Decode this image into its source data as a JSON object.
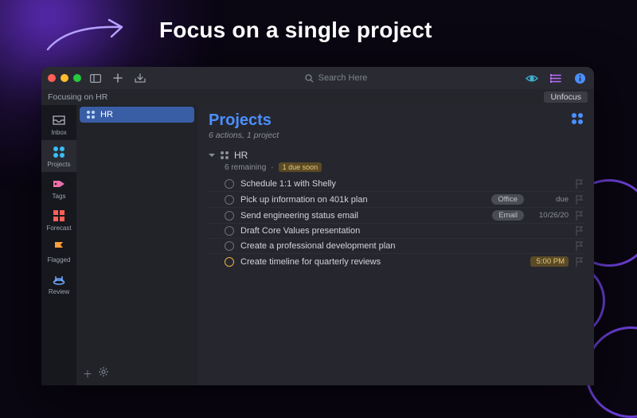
{
  "hero": {
    "title": "Focus on a single project"
  },
  "titlebar": {
    "search_placeholder": "Search Here"
  },
  "focusbar": {
    "text": "Focusing on HR",
    "unfocus_label": "Unfocus"
  },
  "rail": {
    "items": [
      {
        "label": "Inbox",
        "icon": "inbox-icon"
      },
      {
        "label": "Projects",
        "icon": "projects-icon"
      },
      {
        "label": "Tags",
        "icon": "tag-icon"
      },
      {
        "label": "Forecast",
        "icon": "forecast-icon"
      },
      {
        "label": "Flagged",
        "icon": "flag-icon"
      },
      {
        "label": "Review",
        "icon": "review-icon"
      }
    ]
  },
  "sidebar": {
    "project": {
      "name": "HR"
    }
  },
  "main": {
    "title": "Projects",
    "subtitle": "6 actions, 1 project",
    "group": {
      "name": "HR",
      "remaining": "6 remaining",
      "due_pill": "1 due soon"
    },
    "tasks": [
      {
        "label": "Schedule 1:1 with Shelly",
        "tag": "",
        "meta": "",
        "soon": false
      },
      {
        "label": "Pick up information on 401k plan",
        "tag": "Office",
        "meta": "due",
        "soon": false
      },
      {
        "label": "Send engineering status email",
        "tag": "Email",
        "meta": "10/26/20",
        "soon": false
      },
      {
        "label": "Draft Core Values presentation",
        "tag": "",
        "meta": "",
        "soon": false
      },
      {
        "label": "Create a professional development plan",
        "tag": "",
        "meta": "",
        "soon": false
      },
      {
        "label": "Create timeline for quarterly reviews",
        "tag": "",
        "meta": "5:00 PM",
        "soon": true
      }
    ]
  },
  "colors": {
    "accent": "#4a90ff",
    "warn": "#e8b23a"
  }
}
